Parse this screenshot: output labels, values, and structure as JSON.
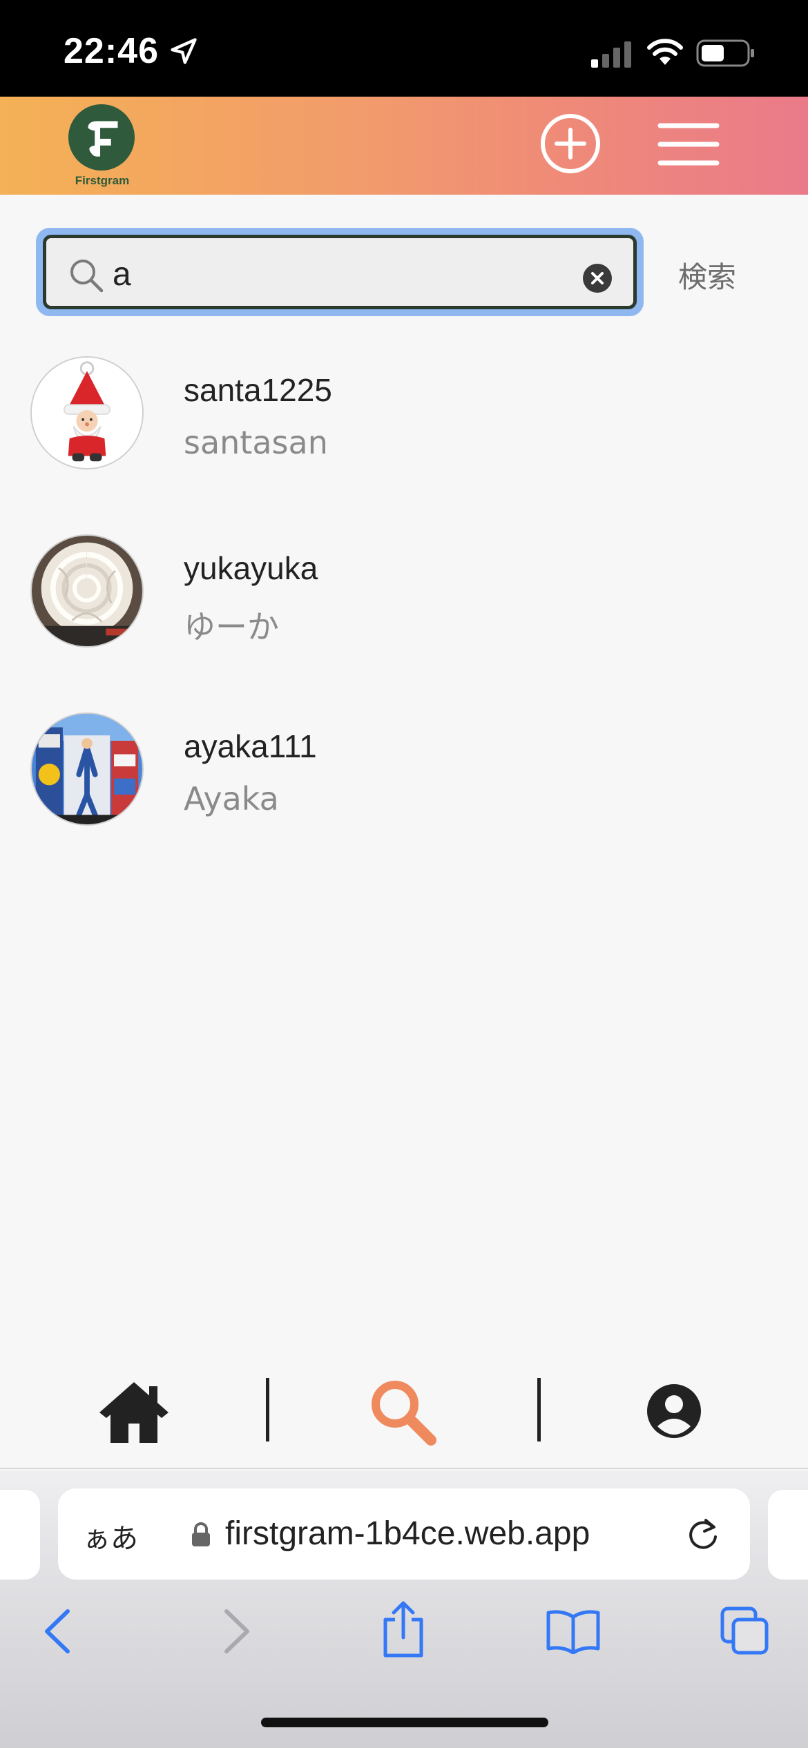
{
  "status_bar": {
    "time": "22:46"
  },
  "header": {
    "logo_text": "Firstgram"
  },
  "search": {
    "value": "a",
    "submit_label": "検索"
  },
  "results": [
    {
      "username": "santa1225",
      "display_name": "santasan",
      "avatar": "santa-avatar"
    },
    {
      "username": "yukayuka",
      "display_name": "ゆーか",
      "avatar": "cream-dessert-avatar"
    },
    {
      "username": "ayaka111",
      "display_name": "Ayaka",
      "avatar": "glico-sign-avatar"
    }
  ],
  "bottom_nav": {
    "items": [
      "home-icon",
      "search-icon",
      "profile-icon"
    ],
    "active": "search-icon",
    "active_color": "#ee8a5e"
  },
  "safari": {
    "aa_label": "ぁあ",
    "url": "firstgram-1b4ce.web.app"
  },
  "colors": {
    "header_start": "#f4b155",
    "header_end": "#ea7a8a",
    "accent_blue": "#3478f6"
  }
}
